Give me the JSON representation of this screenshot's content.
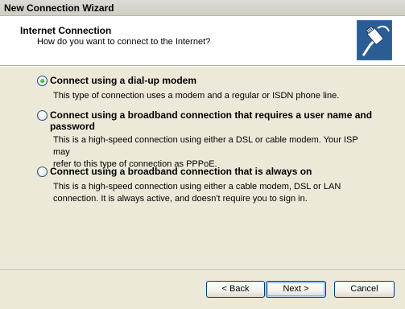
{
  "window": {
    "title": "New Connection Wizard"
  },
  "header": {
    "title": "Internet Connection",
    "subtitle": "How do you want to connect to the Internet?",
    "icon": "network-plug-icon"
  },
  "options": [
    {
      "label": "Connect using a dial-up modem",
      "description_lines": [
        "This type of connection uses a modem and a regular or ISDN phone line."
      ],
      "selected": true
    },
    {
      "label_lines": [
        "Connect using a broadband connection that requires a user name and",
        "password"
      ],
      "description_lines": [
        "This is a high-speed connection using either a DSL or cable modem. Your ISP may",
        "refer to this type of connection as PPPoE."
      ],
      "selected": false
    },
    {
      "label": "Connect using a broadband connection that is always on",
      "description_lines": [
        "This is a high-speed connection using either a cable modem, DSL or LAN",
        "connection. It is always active, and doesn't require you to sign in."
      ],
      "selected": false
    }
  ],
  "buttons": {
    "back": "< Back",
    "next": "Next >",
    "cancel": "Cancel"
  }
}
